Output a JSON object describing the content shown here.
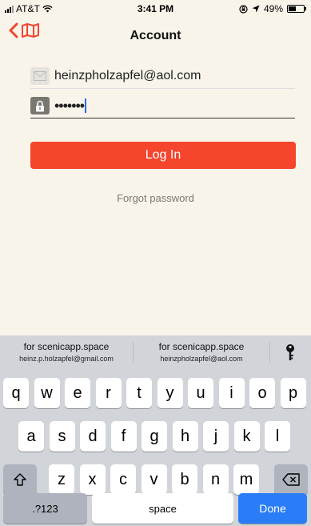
{
  "status_bar": {
    "carrier": "AT&T",
    "time": "3:41 PM",
    "battery": "49%",
    "battery_level": 0.49
  },
  "nav": {
    "title": "Account",
    "back_icon": "chevron-left-icon",
    "map_icon": "map-icon"
  },
  "form": {
    "email": "heinzpholzapfel@aol.com",
    "password_masked": "•••••••",
    "login_label": "Log In",
    "forgot_label": "Forgot password"
  },
  "keyboard": {
    "suggestions": [
      {
        "site": "for scenicapp.space",
        "user": "heinz.p.holzapfel@gmail.com"
      },
      {
        "site": "for scenicapp.space",
        "user": "heinzpholzapfel@aol.com"
      }
    ],
    "row1": [
      "q",
      "w",
      "e",
      "r",
      "t",
      "y",
      "u",
      "i",
      "o",
      "p"
    ],
    "row2": [
      "a",
      "s",
      "d",
      "f",
      "g",
      "h",
      "j",
      "k",
      "l"
    ],
    "row3": [
      "z",
      "x",
      "c",
      "v",
      "b",
      "n",
      "m"
    ],
    "numbers_label": ".?123",
    "space_label": "space",
    "done_label": "Done"
  },
  "colors": {
    "accent": "#f5452d",
    "background": "#f8f4ea",
    "keyboard": "#d1d4d9",
    "done": "#2b7cf7"
  }
}
